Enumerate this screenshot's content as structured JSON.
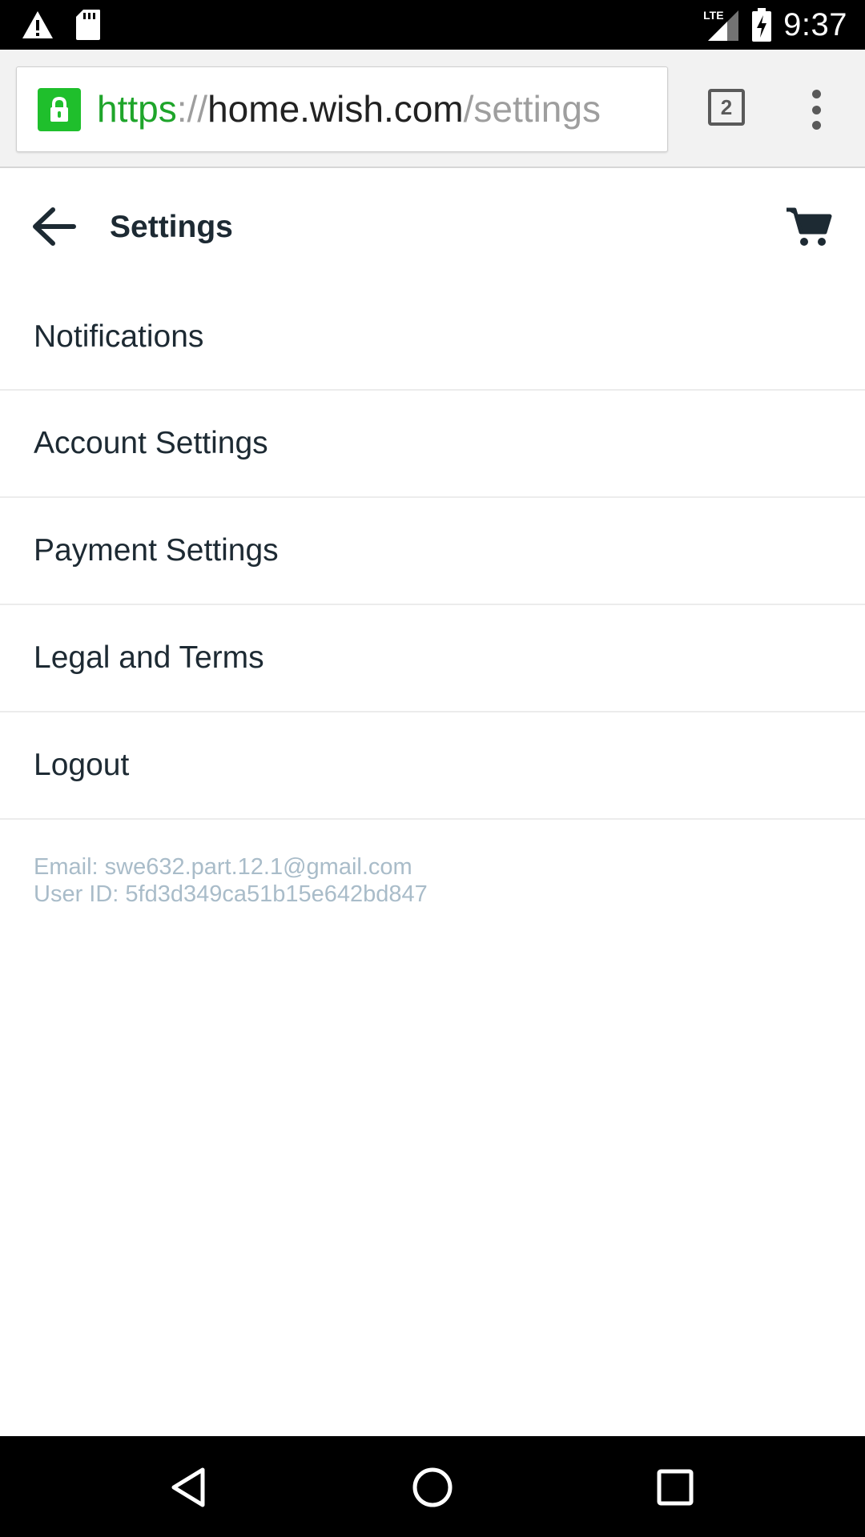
{
  "status_bar": {
    "time": "9:37",
    "network_label": "LTE",
    "icons": [
      "warning-icon",
      "sd-card-icon",
      "signal-icon",
      "battery-charging-icon"
    ]
  },
  "browser": {
    "url_scheme": "https",
    "url_separator": "://",
    "url_host": "home.wish.com",
    "url_path": "/settings",
    "tab_count": "2",
    "icons": [
      "lock-icon",
      "tabs-icon",
      "overflow-menu-icon"
    ],
    "colors": {
      "secure_green": "#1fbf2c",
      "scheme_text": "#1fa52b"
    }
  },
  "header": {
    "title": "Settings",
    "icons": [
      "back-arrow-icon",
      "cart-icon"
    ]
  },
  "settings_items": [
    {
      "label": "Notifications"
    },
    {
      "label": "Account Settings"
    },
    {
      "label": "Payment Settings"
    },
    {
      "label": "Legal and Terms"
    },
    {
      "label": "Logout"
    }
  ],
  "account": {
    "email_line": "Email: swe632.part.12.1@gmail.com",
    "user_id_line": "User ID: 5fd3d349ca51b15e642bd847"
  },
  "nav_bar": {
    "icons": [
      "back-triangle-icon",
      "home-circle-icon",
      "recents-square-icon"
    ]
  },
  "theme": {
    "text_primary": "#1d2a33",
    "text_muted": "#a9bcc9",
    "divider": "#ececec"
  }
}
